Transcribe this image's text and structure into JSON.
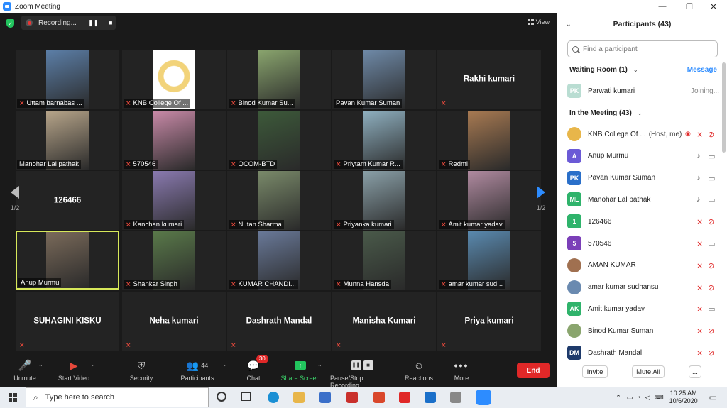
{
  "window": {
    "title": "Zoom Meeting",
    "minimize": "—",
    "maximize": "❐",
    "close": "✕"
  },
  "recording": {
    "status": "Recording...",
    "pause": "❚❚",
    "stop": "■"
  },
  "view": {
    "label": "View"
  },
  "pager": {
    "left": "1/2",
    "right": "1/2"
  },
  "tiles": [
    {
      "label": "Uttam barnabas ...",
      "muted": true,
      "type": "video",
      "color": "#5c7fa8"
    },
    {
      "label": "KNB College Of ...",
      "muted": true,
      "type": "logo",
      "color": "#f2d37a"
    },
    {
      "label": "Binod Kumar Su...",
      "muted": true,
      "type": "video",
      "color": "#8aa56e"
    },
    {
      "label": "Pavan Kumar Suman",
      "muted": false,
      "type": "video",
      "color": "#6f8aa8"
    },
    {
      "label": "Rakhi kumari",
      "muted": true,
      "type": "name"
    },
    {
      "label": "Manohar Lal pathak",
      "muted": false,
      "type": "video",
      "color": "#b7a58a"
    },
    {
      "label": "570546",
      "muted": true,
      "type": "video",
      "color": "#c98aa8"
    },
    {
      "label": "QCOM-BTD",
      "muted": true,
      "type": "video",
      "color": "#3d5a3a"
    },
    {
      "label": "Priytam Kumar R...",
      "muted": true,
      "type": "video",
      "color": "#8fb0c0"
    },
    {
      "label": "Redmi",
      "muted": true,
      "type": "video",
      "color": "#a87a52"
    },
    {
      "label": "126466",
      "muted": false,
      "type": "name"
    },
    {
      "label": "Kanchan kumari",
      "muted": true,
      "type": "video",
      "color": "#8a7ab0"
    },
    {
      "label": "Nutan Sharma",
      "muted": true,
      "type": "video",
      "color": "#7a8a6a"
    },
    {
      "label": "Priyanka kumari",
      "muted": true,
      "type": "video",
      "color": "#8aa0a8"
    },
    {
      "label": "Amit kumar yadav",
      "muted": true,
      "type": "video",
      "color": "#b08aa0"
    },
    {
      "label": "Anup Murmu",
      "muted": false,
      "type": "video",
      "color": "#7a6a5a",
      "active": true
    },
    {
      "label": "Shankar Singh",
      "muted": true,
      "type": "video",
      "color": "#5a7a4a"
    },
    {
      "label": "KUMAR CHANDI...",
      "muted": true,
      "type": "video",
      "color": "#6a7a9a"
    },
    {
      "label": "Munna Hansda",
      "muted": true,
      "type": "video",
      "color": "#4a5a4a"
    },
    {
      "label": "amar kumar sud...",
      "muted": true,
      "type": "video",
      "color": "#5a8ab0"
    },
    {
      "label": "SUHAGINI KISKU",
      "muted": true,
      "type": "name"
    },
    {
      "label": "Neha kumari",
      "muted": true,
      "type": "name"
    },
    {
      "label": "Dashrath Mandal",
      "muted": true,
      "type": "name"
    },
    {
      "label": "Manisha Kumari",
      "muted": true,
      "type": "name"
    },
    {
      "label": "Priya kumari",
      "muted": true,
      "type": "name"
    }
  ],
  "toolbar": {
    "unmute": "Unmute",
    "start_video": "Start Video",
    "security": "Security",
    "participants": "Participants",
    "participants_count": "44",
    "chat": "Chat",
    "chat_badge": "30",
    "share_screen": "Share Screen",
    "pause_stop_recording": "Pause/Stop Recording",
    "reactions": "Reactions",
    "more": "More",
    "end": "End"
  },
  "panel": {
    "title": "Participants (43)",
    "search_placeholder": "Find a participant",
    "waiting_room": "Waiting Room (1)",
    "message": "Message",
    "waiting": [
      {
        "initials": "PK",
        "name": "Parwati kumari",
        "status": "Joining...",
        "color": "#b9ddd2"
      }
    ],
    "in_meeting": "In the Meeting (43)",
    "participants": [
      {
        "initials": "",
        "name": "KNB College Of ...",
        "role": "(Host, me)",
        "color": "#e8b64a",
        "mic": "muted",
        "video": "off",
        "rec": true
      },
      {
        "initials": "A",
        "name": "Anup Murmu",
        "color": "#6b5ad6",
        "mic": "on",
        "video": "on"
      },
      {
        "initials": "PK",
        "name": "Pavan Kumar Suman",
        "color": "#2a6fc9",
        "mic": "on",
        "video": "on"
      },
      {
        "initials": "ML",
        "name": "Manohar Lal pathak",
        "color": "#2fb36b",
        "mic": "on",
        "video": "on"
      },
      {
        "initials": "1",
        "name": "126466",
        "color": "#2fb36b",
        "mic": "muted",
        "video": "off"
      },
      {
        "initials": "5",
        "name": "570546",
        "color": "#7b3fb8",
        "mic": "muted",
        "video": "on"
      },
      {
        "initials": "",
        "name": "AMAN KUMAR",
        "color": "#a07050",
        "mic": "muted",
        "video": "off"
      },
      {
        "initials": "",
        "name": "amar kumar sudhansu",
        "color": "#6a8ab0",
        "mic": "muted",
        "video": "off"
      },
      {
        "initials": "AK",
        "name": "Amit kumar yadav",
        "color": "#2fb36b",
        "mic": "muted",
        "video": "on"
      },
      {
        "initials": "",
        "name": "Binod Kumar Suman",
        "color": "#8aa56e",
        "mic": "muted",
        "video": "off"
      },
      {
        "initials": "DM",
        "name": "Dashrath Mandal",
        "color": "#1e3a6b",
        "mic": "muted",
        "video": "off"
      }
    ],
    "invite": "Invite",
    "mute_all": "Mute All",
    "more": "..."
  },
  "taskbar": {
    "search_placeholder": "Type here to search",
    "time": "10:25 AM",
    "date": "10/6/2020"
  }
}
